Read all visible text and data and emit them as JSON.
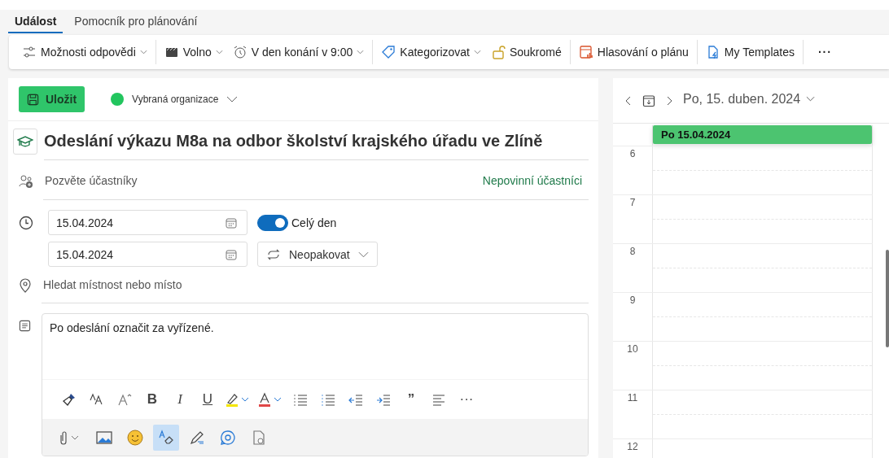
{
  "tabs": [
    {
      "label": "Událost",
      "selected": true
    },
    {
      "label": "Pomocník pro plánování",
      "selected": false
    }
  ],
  "toolbar": {
    "groups": [
      [
        {
          "label": "Možnosti odpovědi",
          "dropdown": true
        }
      ],
      [
        {
          "label": "Volno",
          "dropdown": true
        },
        {
          "label": "V den konání v 9:00",
          "dropdown": true
        }
      ],
      [
        {
          "label": "Kategorizovat",
          "dropdown": true
        },
        {
          "label": "Soukromé",
          "dropdown": false
        }
      ],
      [
        {
          "label": "Hlasování o plánu",
          "dropdown": false
        }
      ],
      [
        {
          "label": "My Templates",
          "dropdown": false
        }
      ]
    ],
    "more": "···"
  },
  "editor": {
    "save": "Uložit",
    "organization": {
      "name": "Vybraná organizace",
      "color": "#22c55e"
    },
    "title": "Odeslání výkazu M8a na odbor školství krajského úřadu ve Zlíně",
    "attendees": {
      "placeholder": "Pozvěte účastníky"
    },
    "optional_attendees": "Nepovinní účastníci",
    "start_date": "15.04.2024",
    "end_date": "15.04.2024",
    "all_day": {
      "label": "Celý den",
      "on": true
    },
    "repeat": "Neopakovat",
    "location": {
      "placeholder": "Hledat místnost nebo místo"
    },
    "body": "Po odeslání označit za vyřízené.",
    "format_tools": [
      {
        "kind": "painter"
      },
      {
        "kind": "font-size"
      },
      {
        "kind": "grow-font"
      },
      {
        "kind": "bold",
        "text": "B"
      },
      {
        "kind": "italic",
        "text": "I"
      },
      {
        "kind": "underline",
        "text": "U"
      },
      {
        "kind": "highlight"
      },
      {
        "kind": "font-color"
      },
      {
        "kind": "bullets"
      },
      {
        "kind": "numbering"
      },
      {
        "kind": "outdent"
      },
      {
        "kind": "indent"
      },
      {
        "kind": "quote",
        "text": "”"
      },
      {
        "kind": "align"
      },
      {
        "kind": "more",
        "text": "···"
      }
    ],
    "insert_tools": [
      {
        "kind": "attach",
        "selected": false
      },
      {
        "kind": "image",
        "selected": false
      },
      {
        "kind": "emoji",
        "selected": false
      },
      {
        "kind": "editor",
        "selected": true
      },
      {
        "kind": "signature",
        "selected": false
      },
      {
        "kind": "loop",
        "selected": false
      },
      {
        "kind": "document",
        "selected": false
      }
    ]
  },
  "calendar": {
    "date": "Po, 15. duben. 2024",
    "event": {
      "title": "Po 15.04.2024",
      "color": "#4cc470"
    },
    "hours": [
      "6",
      "7",
      "8",
      "9",
      "10",
      "11",
      "12"
    ]
  }
}
